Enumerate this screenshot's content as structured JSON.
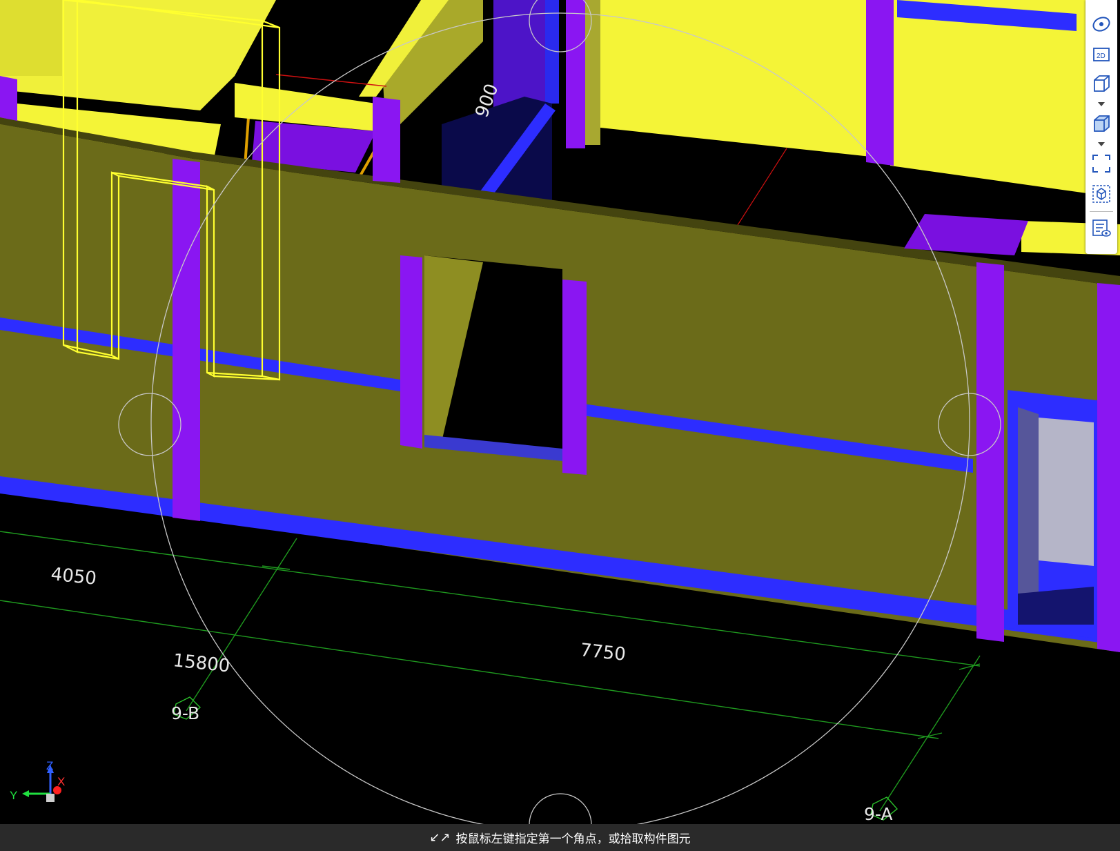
{
  "dimensions": {
    "d900": "900",
    "d4050": "4050",
    "d15800": "15800",
    "d7750": "7750"
  },
  "axis_tags": {
    "grid_9b": "9-B",
    "grid_9a": "9-A"
  },
  "view_cube": {
    "z": "Z",
    "x": "X",
    "y": "Y"
  },
  "toolbar": {
    "items": [
      {
        "name": "orbit",
        "label": ""
      },
      {
        "name": "view-2d",
        "label": "2D"
      },
      {
        "name": "view-3d-wire",
        "label": ""
      },
      {
        "name": "view-3d-solid",
        "label": ""
      },
      {
        "name": "fit-view",
        "label": ""
      },
      {
        "name": "section-box",
        "label": ""
      },
      {
        "name": "display-settings",
        "label": ""
      }
    ]
  },
  "status": {
    "message": "按鼠标左键指定第一个角点，或拾取构件图元"
  },
  "colors": {
    "wall_front": "#6b6b19",
    "slab_yellow": "#f4f437",
    "column_purple": "#8a16f2",
    "beam_blue": "#2d2dff",
    "grid_green": "#1f9a1f",
    "background": "#000000"
  }
}
